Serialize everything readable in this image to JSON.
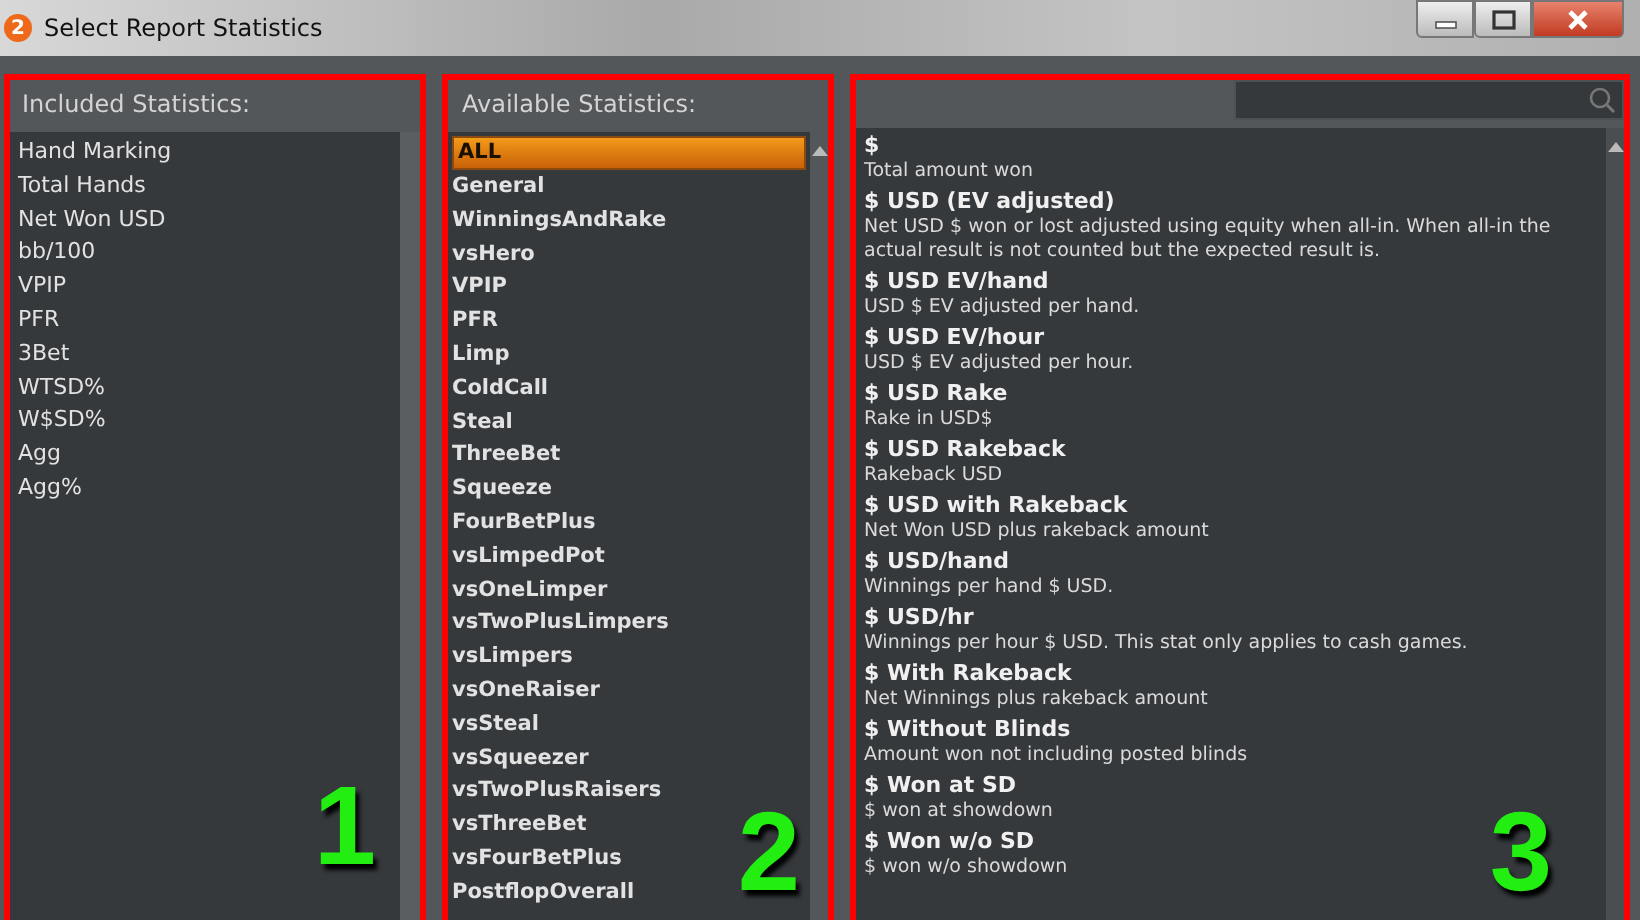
{
  "window": {
    "app_badge": "2",
    "title": "Select Report Statistics"
  },
  "included": {
    "heading": "Included Statistics:",
    "callout": "1",
    "items": [
      "Hand Marking",
      "Total Hands",
      "Net Won USD",
      "bb/100",
      "VPIP",
      "PFR",
      "3Bet",
      "WTSD%",
      "W$SD%",
      "Agg",
      "Agg%"
    ]
  },
  "available": {
    "heading": "Available Statistics:",
    "callout": "2",
    "items": [
      {
        "label": "ALL",
        "selected": true
      },
      {
        "label": "General",
        "selected": false
      },
      {
        "label": "WinningsAndRake",
        "selected": false
      },
      {
        "label": "vsHero",
        "selected": false
      },
      {
        "label": "VPIP",
        "selected": false
      },
      {
        "label": "PFR",
        "selected": false
      },
      {
        "label": "Limp",
        "selected": false
      },
      {
        "label": "ColdCall",
        "selected": false
      },
      {
        "label": "Steal",
        "selected": false
      },
      {
        "label": "ThreeBet",
        "selected": false
      },
      {
        "label": "Squeeze",
        "selected": false
      },
      {
        "label": "FourBetPlus",
        "selected": false
      },
      {
        "label": "vsLimpedPot",
        "selected": false
      },
      {
        "label": "vsOneLimper",
        "selected": false
      },
      {
        "label": "vsTwoPlusLimpers",
        "selected": false
      },
      {
        "label": "vsLimpers",
        "selected": false
      },
      {
        "label": "vsOneRaiser",
        "selected": false
      },
      {
        "label": "vsSteal",
        "selected": false
      },
      {
        "label": "vsSqueezer",
        "selected": false
      },
      {
        "label": "vsTwoPlusRaisers",
        "selected": false
      },
      {
        "label": "vsThreeBet",
        "selected": false
      },
      {
        "label": "vsFourBetPlus",
        "selected": false
      },
      {
        "label": "PostflopOverall",
        "selected": false
      }
    ]
  },
  "details": {
    "callout": "3",
    "items": [
      {
        "name": "$",
        "description": "Total amount won"
      },
      {
        "name": "$ USD (EV adjusted)",
        "description": "Net USD $ won or lost adjusted using equity when all-in.  When all-in the actual result is not counted but the expected result is."
      },
      {
        "name": "$ USD EV/hand",
        "description": "USD $ EV adjusted per hand."
      },
      {
        "name": "$ USD EV/hour",
        "description": "USD $ EV adjusted per hour."
      },
      {
        "name": "$ USD Rake",
        "description": "Rake in USD$"
      },
      {
        "name": "$ USD Rakeback",
        "description": "Rakeback USD"
      },
      {
        "name": "$ USD with Rakeback",
        "description": "Net Won USD plus rakeback amount"
      },
      {
        "name": "$ USD/hand",
        "description": "Winnings per hand $ USD."
      },
      {
        "name": "$ USD/hr",
        "description": "Winnings per hour $ USD. This stat only applies to cash games."
      },
      {
        "name": "$ With Rakeback",
        "description": "Net Winnings plus rakeback amount"
      },
      {
        "name": "$ Without Blinds",
        "description": "Amount won not including posted blinds"
      },
      {
        "name": "$ Won at SD",
        "description": "$ won at showdown"
      },
      {
        "name": "$ Won w/o SD",
        "description": "$ won w/o showdown"
      }
    ]
  }
}
